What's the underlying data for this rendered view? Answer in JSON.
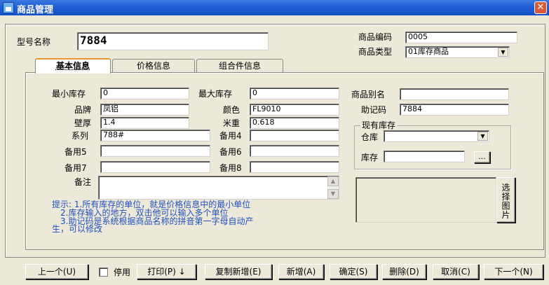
{
  "window": {
    "title": "商品管理",
    "close_label": "✕"
  },
  "header": {
    "model_name_label": "型号名称",
    "model_name_value": "7884",
    "code_label": "商品编码",
    "code_value": "0005",
    "type_label": "商品类型",
    "type_value": "01库存商品"
  },
  "tabs": [
    {
      "label": "基本信息"
    },
    {
      "label": "价格信息"
    },
    {
      "label": "组合件信息"
    }
  ],
  "basic": {
    "min_stock_label": "最小库存",
    "min_stock_value": "0",
    "max_stock_label": "最大库存",
    "max_stock_value": "0",
    "alias_label": "商品别名",
    "alias_value": "",
    "brand_label": "品牌",
    "brand_value": "凤铝",
    "color_label": "颜色",
    "color_value": "FL9010",
    "mnemonic_label": "助记码",
    "mnemonic_value": "7884",
    "wall_label": "壁厚",
    "wall_value": "1.4",
    "weight_label": "米重",
    "weight_value": "0.618",
    "series_label": "系列",
    "series_value": "788#",
    "spare4_label": "备用4",
    "spare4_value": "",
    "spare5_label": "备用5",
    "spare5_value": "",
    "spare6_label": "备用6",
    "spare6_value": "",
    "spare7_label": "备用7",
    "spare7_value": "",
    "spare8_label": "备用8",
    "spare8_value": "",
    "remark_label": "备注",
    "remark_value": ""
  },
  "stock_group": {
    "title": "现有库存",
    "warehouse_label": "仓库",
    "warehouse_value": "",
    "stock_label": "库存",
    "stock_value": "",
    "browse_label": "..."
  },
  "image_button": {
    "label_chars": [
      "选",
      "择",
      "图",
      "片"
    ]
  },
  "notes": [
    "提示: 1.所有库存的单位，就是价格信息中的最小单位",
    "2.库存输入的地方，双击他可以输入多个单位",
    "3.助记码是系统根据商品名称的拼音第一字母自动产",
    "生，可以修改"
  ],
  "footer": {
    "prev_label": "上一个(U)",
    "disable_label": "停用",
    "disable_checked": false,
    "print_label": "打印(P) ↓",
    "copy_new_label": "复制新增(E)",
    "new_label": "新增(A)",
    "ok_label": "确定(S)",
    "delete_label": "删除(D)",
    "cancel_label": "取消(C)",
    "next_label": "下一个(N)"
  }
}
